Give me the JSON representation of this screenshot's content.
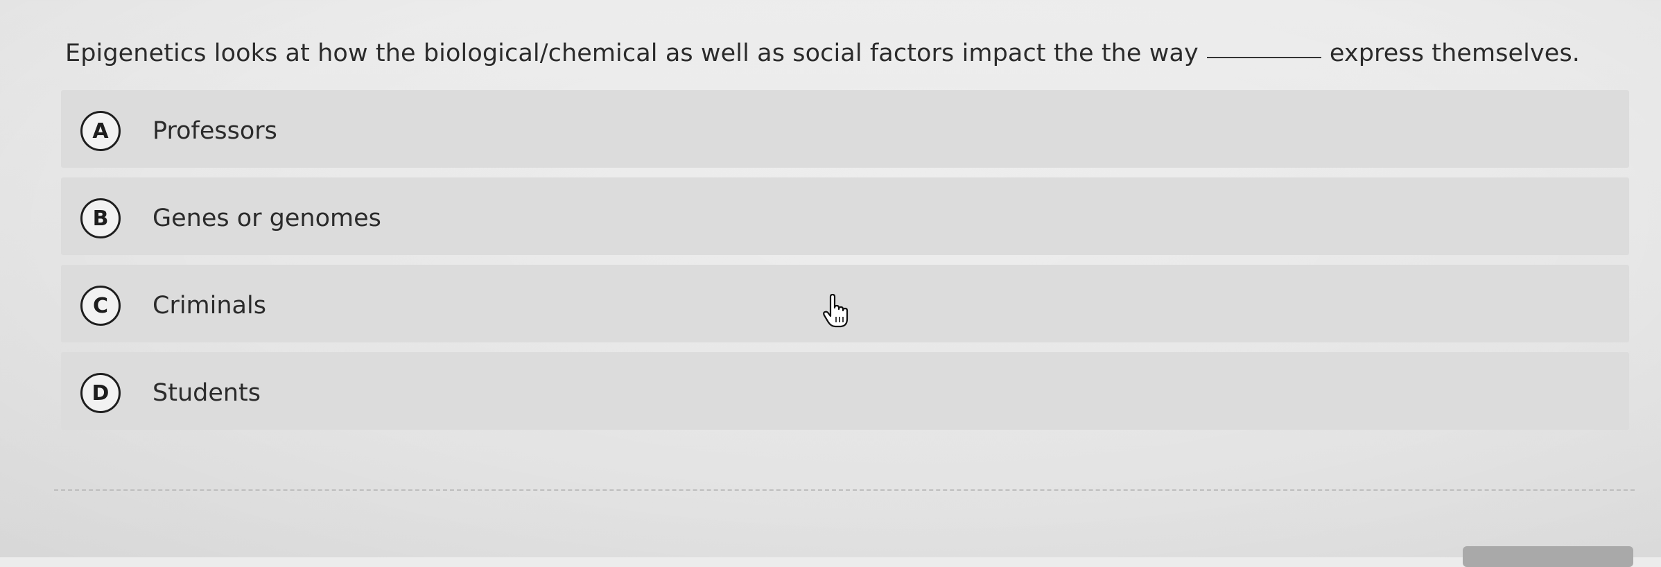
{
  "question": {
    "text_before": "Epigenetics looks at how the biological/chemical as well as social factors impact the the way",
    "text_after": "express themselves."
  },
  "options": [
    {
      "letter": "A",
      "label": "Professors"
    },
    {
      "letter": "B",
      "label": "Genes or genomes"
    },
    {
      "letter": "C",
      "label": "Criminals"
    },
    {
      "letter": "D",
      "label": "Students"
    }
  ],
  "cursor_icon": "hand-pointer-icon",
  "colors": {
    "background": "#e6e6e6",
    "option_background": "#dcdcdc",
    "text": "#2b2b2b",
    "letter_circle_border": "#1e1e1e"
  }
}
